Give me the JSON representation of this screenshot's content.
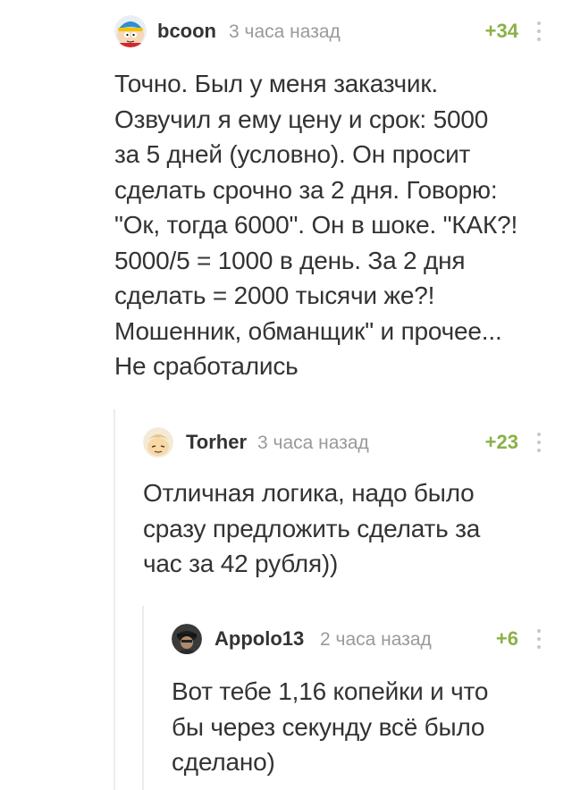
{
  "comments": [
    {
      "username": "bcoon",
      "time": "3 часа назад",
      "rating": "+34",
      "avatar_icon": "cartman-avatar",
      "text": "Точно. Был у меня заказчик.\nОзвучил я ему цену и срок: 5000\nза 5 дней (условно). Он просит\nсделать срочно за 2 дня. Говорю:\n\"Ок, тогда 6000\". Он в шоке. \"КАК?!\n5000/5 = 1000 в день. За 2 дня\nсделать = 2000 тысячи же?!\nМошенник, обманщик\" и прочее...\nНе сработались"
    },
    {
      "username": "Torher",
      "time": "3 часа назад",
      "rating": "+23",
      "avatar_icon": "cartoon-face-avatar",
      "text": "Отличная логика, надо было\nсразу предложить сделать за\nчас за 42 рубля))"
    },
    {
      "username": "Appolo13",
      "time": "2 часа назад",
      "rating": "+6",
      "avatar_icon": "photo-avatar",
      "text": "Вот тебе 1,16 копейки и что\nбы через секунду всё было\nсделано)"
    }
  ],
  "colors": {
    "rating": "#8ab146",
    "meta": "#9a9a9a",
    "text": "#333333",
    "thread_line": "#ececec"
  }
}
